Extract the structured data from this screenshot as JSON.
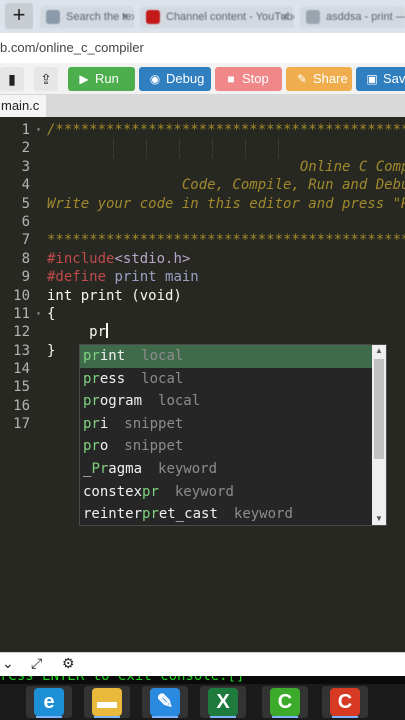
{
  "browser": {
    "new_tab": "+",
    "tabs": [
      {
        "label": "Search the text — G",
        "fav_color": "#8a9aaa"
      },
      {
        "label": "Channel content - YouTube",
        "fav_color": "#c41a1a"
      },
      {
        "label": "asddsa - print — C",
        "fav_color": "#9aa4ae"
      }
    ],
    "tab_close": "×",
    "url": "b.com/online_c_compiler"
  },
  "toolbar": {
    "file_icon": "▮",
    "upload_icon": "⇪",
    "buttons": [
      {
        "label": "Run",
        "icon": "▶",
        "color": "#4cae4c"
      },
      {
        "label": "Debug",
        "icon": "◉",
        "color": "#2f7fc1"
      },
      {
        "label": "Stop",
        "icon": "■",
        "color": "#f0888a"
      },
      {
        "label": "Share",
        "icon": "✎",
        "color": "#f0ad4e"
      },
      {
        "label": "Save",
        "icon": "▣",
        "color": "#2f7fc1"
      }
    ]
  },
  "file_tab": "main.c",
  "editor": {
    "line_numbers": [
      "1",
      "2",
      "3",
      "4",
      "5",
      "6",
      "7",
      "8",
      "9",
      "10",
      "11",
      "12",
      "13",
      "14",
      "15",
      "16",
      "17"
    ],
    "fold_markers": {
      "1": "▾",
      "11": "▾"
    },
    "lines": {
      "l1": "/**************************************************",
      "l2": "",
      "l3": "                              Online C Compiler",
      "l4": "                Code, Compile, Run and Debug C program online",
      "l5": "Write your code in this editor and press \"Run\" button",
      "l6": "",
      "l7": "**************************************************",
      "l8_pp": "#include",
      "l8_inc": "<stdio.h>",
      "l9_pp": "#define",
      "l9_mac": " print main",
      "l10": "int print (void)",
      "l11": "{",
      "l12": "     pr",
      "l13": "}"
    }
  },
  "autocomplete": {
    "items": [
      {
        "pre": "",
        "match": "pr",
        "rest": "int",
        "meta": "local"
      },
      {
        "pre": "",
        "match": "pr",
        "rest": "ess",
        "meta": "local"
      },
      {
        "pre": "",
        "match": "pr",
        "rest": "ogram",
        "meta": "local"
      },
      {
        "pre": "",
        "match": "pr",
        "rest": "i",
        "meta": "snippet"
      },
      {
        "pre": "",
        "match": "pr",
        "rest": "o",
        "meta": "snippet"
      },
      {
        "pre": "_",
        "match": "Pr",
        "rest": "agma",
        "meta": "keyword"
      },
      {
        "pre": "constex",
        "match": "pr",
        "rest": "",
        "meta": "keyword"
      },
      {
        "pre": "reinter",
        "match": "pr",
        "rest": "et_cast",
        "meta": "keyword"
      }
    ],
    "selected_index": 0,
    "scroll_up": "▲",
    "scroll_down": "▼"
  },
  "console": {
    "collapse_icon": "⌄",
    "expand_icon": "⤢",
    "settings_icon": "⚙",
    "output": "ress ENTER to exit console.[]"
  },
  "taskbar": {
    "apps": [
      {
        "name": "edge-icon",
        "glyph": "e",
        "color": "#1c8fd6"
      },
      {
        "name": "file-explorer-icon",
        "glyph": "▬",
        "color": "#e8b93a"
      },
      {
        "name": "pen-app-icon",
        "glyph": "✎",
        "color": "#2a8ae0"
      },
      {
        "name": "excel-icon",
        "glyph": "X",
        "color": "#1f7a3e"
      },
      {
        "name": "camtasia-green-icon",
        "glyph": "C",
        "color": "#3cab2c"
      },
      {
        "name": "camtasia-red-icon",
        "glyph": "C",
        "color": "#d63a22"
      }
    ]
  }
}
